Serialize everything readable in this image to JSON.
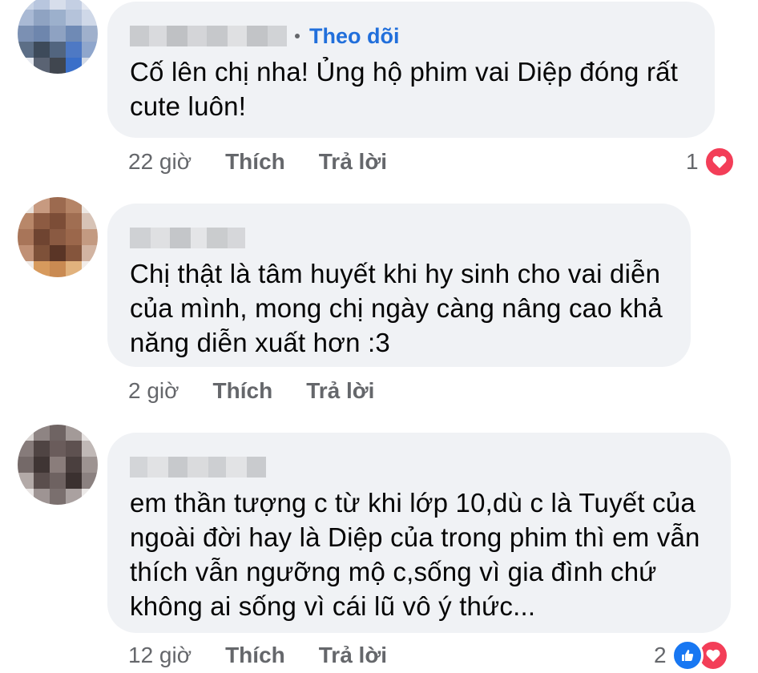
{
  "comments": [
    {
      "follow_label": "Theo dõi",
      "text": "Cố lên chị nha! Ủng hộ phim vai Diệp đóng rất cute luôn!",
      "time": "22 giờ",
      "like_label": "Thích",
      "reply_label": "Trả lời",
      "reaction_count": "1",
      "reactions": [
        "love-icon"
      ]
    },
    {
      "text": "Chị thật là tâm huyết khi hy sinh cho vai diễn của mình, mong chị ngày càng nâng cao khả năng diễn xuất hơn :3",
      "time": "2 giờ",
      "like_label": "Thích",
      "reply_label": "Trả lời"
    },
    {
      "text": "em thần tượng c từ khi lớp 10,dù c là Tuyết của ngoài đời hay là Diệp của trong phim thì em vẫn thích vẫn ngưỡng mộ c,sống vì gia đình chứ không ai sống vì cái lũ vô ý thức...",
      "time": "12 giờ",
      "like_label": "Thích",
      "reply_label": "Trả lời",
      "reaction_count": "2",
      "reactions": [
        "like-icon",
        "love-icon"
      ]
    }
  ],
  "colors": {
    "bubble": "#f0f2f5",
    "follow": "#216fdb",
    "meta": "#65676b",
    "love": "#f33e58",
    "like": "#1877f2"
  }
}
